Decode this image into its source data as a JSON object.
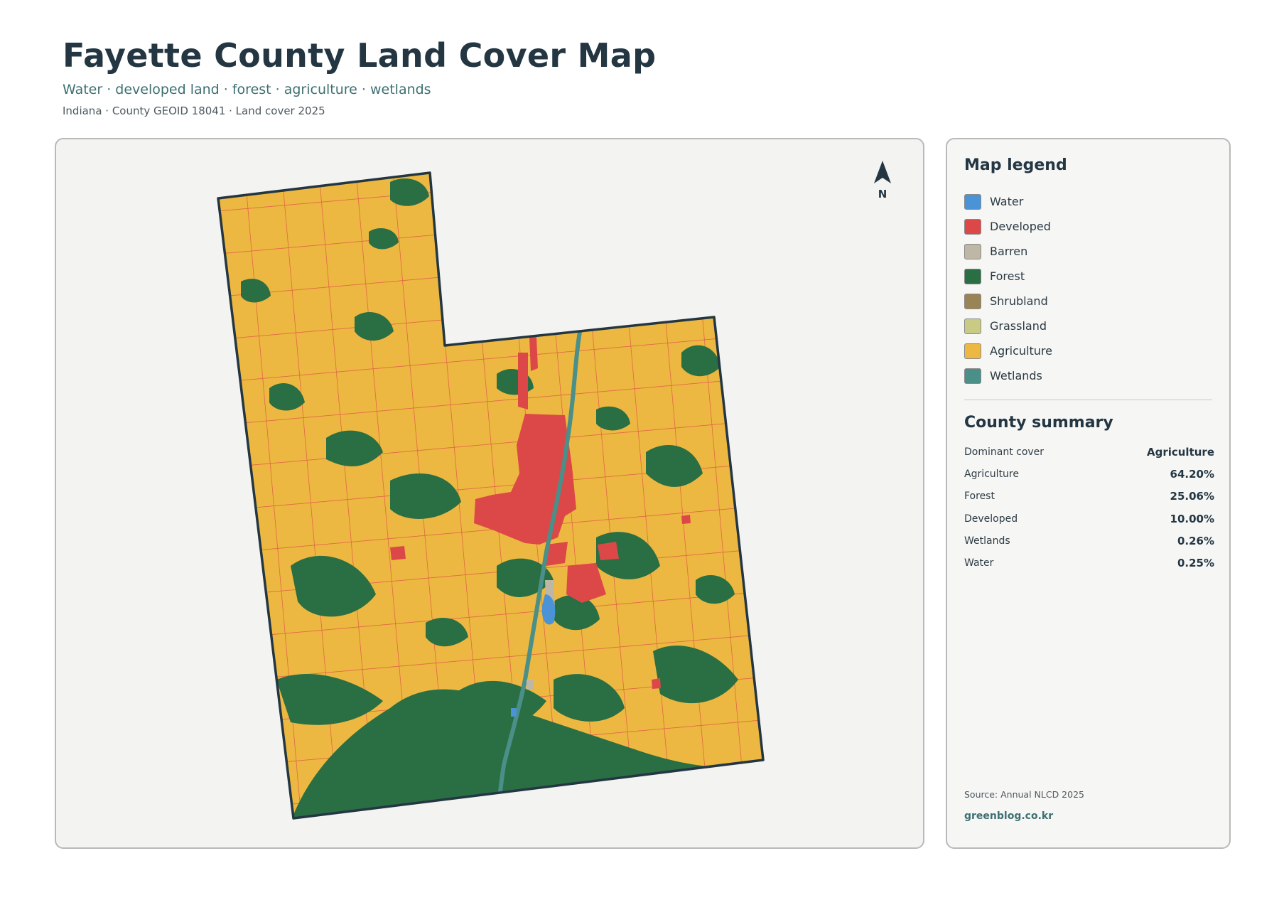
{
  "header": {
    "title": "Fayette County Land Cover Map",
    "subtitle": "Water · developed land · forest · agriculture · wetlands",
    "meta": "Indiana · County GEOID 18041 · Land cover 2025"
  },
  "map": {
    "north_label": "N",
    "colors": {
      "water": "#4a93d6",
      "developed": "#dc4848",
      "barren": "#bfb7a6",
      "forest": "#2a6e43",
      "shrubland": "#9a8455",
      "grassland": "#c9cb85",
      "agriculture": "#edb841",
      "wetlands": "#4a8f88",
      "boundary": "#233642"
    }
  },
  "legend": {
    "title": "Map legend",
    "items": [
      {
        "label": "Water",
        "color": "#4a93d6"
      },
      {
        "label": "Developed",
        "color": "#dc4848"
      },
      {
        "label": "Barren",
        "color": "#bfb7a6"
      },
      {
        "label": "Forest",
        "color": "#2a6e43"
      },
      {
        "label": "Shrubland",
        "color": "#9a8455"
      },
      {
        "label": "Grassland",
        "color": "#c9cb85"
      },
      {
        "label": "Agriculture",
        "color": "#edb841"
      },
      {
        "label": "Wetlands",
        "color": "#4a8f88"
      }
    ]
  },
  "summary": {
    "title": "County summary",
    "rows": [
      {
        "key": "Dominant cover",
        "value": "Agriculture"
      },
      {
        "key": "Agriculture",
        "value": "64.20%"
      },
      {
        "key": "Forest",
        "value": "25.06%"
      },
      {
        "key": "Developed",
        "value": "10.00%"
      },
      {
        "key": "Wetlands",
        "value": "0.26%"
      },
      {
        "key": "Water",
        "value": "0.25%"
      }
    ]
  },
  "footer": {
    "source": "Source: Annual NLCD 2025",
    "site": "greenblog.co.kr"
  }
}
